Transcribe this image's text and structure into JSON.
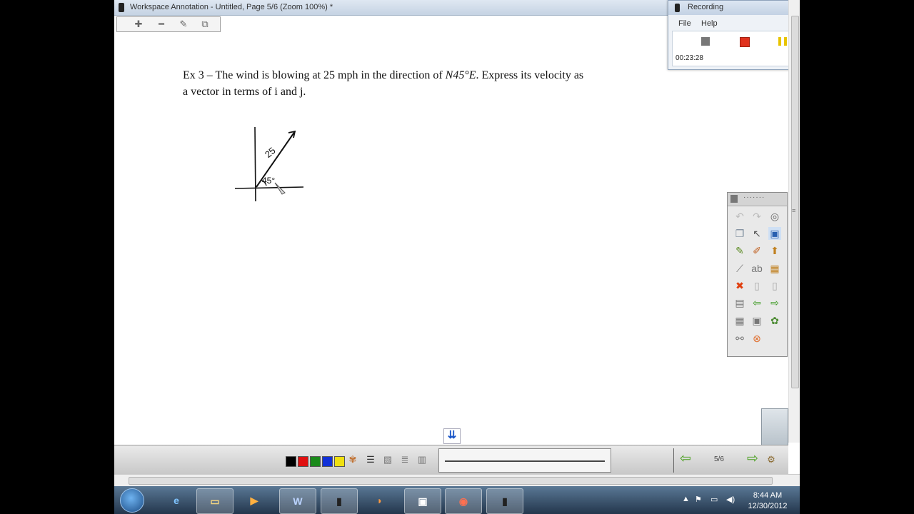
{
  "window": {
    "title": "Workspace Annotation - Untitled, Page 5/6 (Zoom 100%) *"
  },
  "toolbar": {
    "icons": [
      "plus-icon",
      "minus-icon",
      "edit-icon",
      "pages-icon"
    ]
  },
  "content": {
    "problem_line1_a": "Ex 3 – The wind is blowing at 25 mph in the direction of",
    "problem_math": "N45°E",
    "problem_line1_b": ". Express its velocity as",
    "problem_line2": "a vector in terms of i and j."
  },
  "sketch": {
    "magnitude_label": "25",
    "angle_label": "45°"
  },
  "recorder": {
    "title": "Recording",
    "menu_file": "File",
    "menu_help": "Help",
    "timer": "00:23:28",
    "colors": {
      "stop": "#777777",
      "record": "#e0321e",
      "pause": "#e8c400"
    }
  },
  "palette": {
    "title": "·······"
  },
  "annotation_bar": {
    "colors": [
      "#000000",
      "#e01010",
      "#1a8a1a",
      "#1030d8",
      "#f0e010"
    ],
    "page_indicator": "5/6"
  },
  "taskbar": {
    "clock_time": "8:44 AM",
    "clock_date": "12/30/2012",
    "apps": [
      "start-button",
      "ie-icon",
      "explorer-icon",
      "media-player-icon",
      "word-icon",
      "workspace-icon",
      "fireworks-icon",
      "network-icon",
      "browser-icon",
      "workspace-icon-2"
    ]
  }
}
